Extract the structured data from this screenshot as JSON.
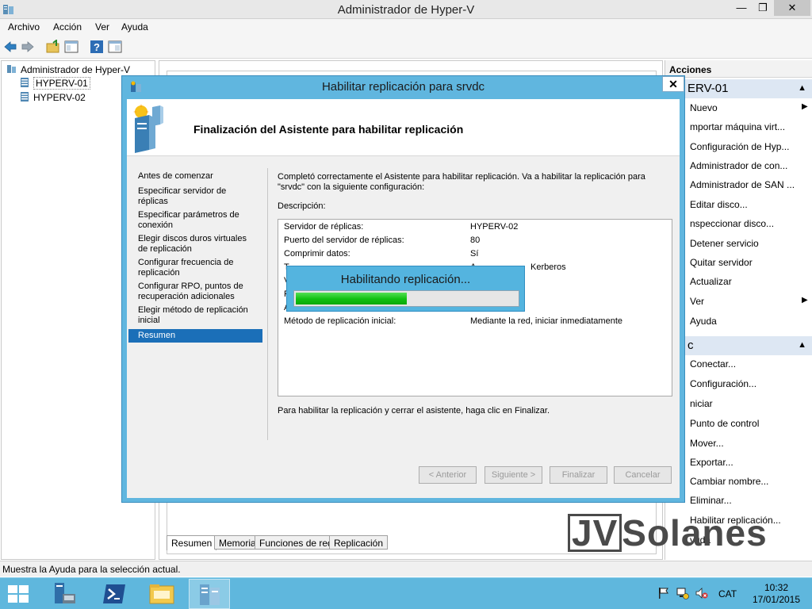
{
  "window": {
    "title": "Administrador de Hyper-V",
    "controls": {
      "minimize": "—",
      "maximize": "❐",
      "close": "✕"
    }
  },
  "menu": [
    "Archivo",
    "Acción",
    "Ver",
    "Ayuda"
  ],
  "toolbar_icons": [
    "back-icon",
    "forward-icon",
    "up-folder-icon",
    "show-hide-tree-icon",
    "help-icon",
    "properties-icon"
  ],
  "tree": {
    "root": "Administrador de Hyper-V",
    "servers": [
      "HYPERV-01",
      "HYPERV-02"
    ],
    "selected": "HYPERV-01"
  },
  "detail_tabs": [
    "Resumen",
    "Memoria",
    "Funciones de red",
    "Replicación"
  ],
  "actions": {
    "header": "Acciones",
    "group1": {
      "title": "ERV-01",
      "items": [
        "Nuevo",
        "mportar máquina virt...",
        "Configuración de Hyp...",
        "Administrador de con...",
        "Administrador de SAN ...",
        "Editar disco...",
        "nspeccionar disco...",
        "Detener servicio",
        "Quitar servidor",
        "Actualizar",
        "Ver",
        "Ayuda"
      ]
    },
    "group2": {
      "title": "c",
      "items": [
        "Conectar...",
        "Configuración...",
        "niciar",
        "Punto de control",
        "Mover...",
        "Exportar...",
        "Cambiar nombre...",
        "Eliminar...",
        "Habilitar replicación...",
        "yuda"
      ]
    }
  },
  "statusbar": "Muestra la Ayuda para la selección actual.",
  "dialog": {
    "title": "Habilitar replicación para srvdc",
    "close": "✕",
    "heading": "Finalización del Asistente para habilitar replicación",
    "steps": [
      "Antes de comenzar",
      "Especificar servidor de réplicas",
      "Especificar parámetros de conexión",
      "Elegir discos duros virtuales de replicación",
      "Configurar frecuencia de replicación",
      "Configurar RPO, puntos de recuperación adicionales",
      "Elegir método de replicación inicial",
      "Resumen"
    ],
    "active_step": "Resumen",
    "intro": "Completó correctamente el Asistente para habilitar replicación. Va a habilitar la replicación para \"srvdc\" con la siguiente configuración:",
    "description_label": "Descripción:",
    "rows": [
      {
        "k": "Servidor de réplicas:",
        "v": "HYPERV-02"
      },
      {
        "k": "Puerto del servidor de réplicas:",
        "v": "80"
      },
      {
        "k": "Comprimir datos:",
        "v": "Sí"
      },
      {
        "k": "T",
        "v": "A",
        "v2": "Kerberos"
      },
      {
        "k": "V",
        "v": ""
      },
      {
        "k": "F",
        "v": ""
      },
      {
        "k": "A",
        "v": ""
      },
      {
        "k": "Método de replicación inicial:",
        "v": "Mediante la red, iniciar inmediatamente"
      }
    ],
    "outro": "Para habilitar la replicación y cerrar el asistente, haga clic en Finalizar.",
    "buttons": [
      "< Anterior",
      "Siguiente >",
      "Finalizar",
      "Cancelar"
    ]
  },
  "progress": {
    "label": "Habilitando replicación...",
    "value": 0.5
  },
  "taskbar": {
    "apps": [
      "server-manager-icon",
      "powershell-icon",
      "file-explorer-icon",
      "hyper-v-manager-icon"
    ],
    "language": "CAT",
    "time": "10:32",
    "date": "17/01/2015"
  },
  "watermark": {
    "first": "JV",
    "second": "Solanes"
  },
  "colors": {
    "dialog_frame": "#60b6df",
    "selected_step": "#1b6fb8",
    "progress_fill": "#10c010",
    "taskbar": "#5fb7dd"
  }
}
